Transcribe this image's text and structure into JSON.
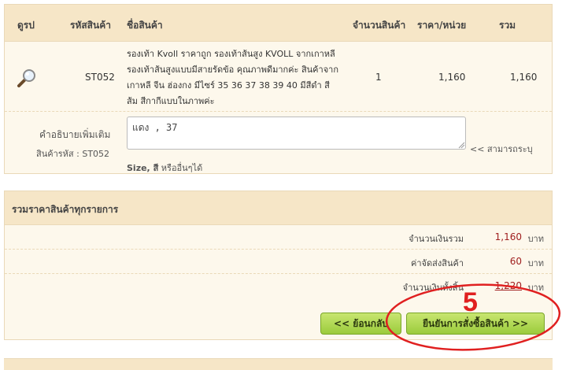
{
  "cart": {
    "headers": {
      "image": "ดูรป",
      "code": "รหัสสินค้า",
      "name": "ชื่อสินค้า",
      "qty": "จำนวนสินค้า",
      "price": "ราคา/หน่วย",
      "total": "รวม"
    },
    "item": {
      "code": "ST052",
      "description": "รองเท้า Kvoll ราคาถูก รองเท้าส้นสูง KVOLL จากเกาหลี รองเท้าส้นสูงแบบมีสายรัดข้อ คุณภาพดีมากค่ะ สินค้าจากเกาหลี จีน ฮ่องกง มีไซร์ 35 36 37 38 39 40 มีสีดำ สีส้ม สีกากีแบบในภาพค่ะ",
      "qty": "1",
      "price": "1,160",
      "total": "1,160"
    },
    "note": {
      "label": "คำอธิบายเพิ่มเติม",
      "code_label": "สินค้ารหัส : ST052",
      "value": "แดง , 37",
      "hint": "<< สามารถระบุ",
      "help_bold": "Size, สี",
      "help_rest": "หรืออื่นๆได้"
    }
  },
  "summary": {
    "title": "รวมราคาสินค้าทุกรายการ",
    "rows": [
      {
        "label": "จำนวนเงินรวม",
        "value": "1,160",
        "unit": "บาท"
      },
      {
        "label": "ค่าจัดส่งสินค้า",
        "value": "60",
        "unit": "บาท"
      },
      {
        "label": "จำนวนเงินทั้งสิ้น",
        "value": "1,220",
        "unit": "บาท"
      }
    ],
    "back_button": "<< ย้อนกลับ",
    "confirm_button": "ยืนยันการสั่งซื้อสินค้า >>"
  },
  "annotation": {
    "step_number": "5",
    "color": "#e02020"
  },
  "colors": {
    "header_bg": "#f6e6c7",
    "panel_bg": "#fdf8ec",
    "border": "#ead9b8",
    "amount_red": "#a02020",
    "button_green": "#9bcb3c"
  },
  "icons": {
    "zoom": "magnifier-icon"
  }
}
